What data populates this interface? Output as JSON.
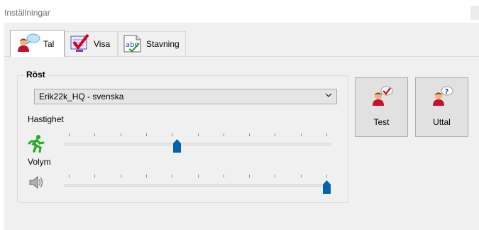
{
  "window": {
    "title": "Inställningar"
  },
  "tabs": [
    {
      "label": "Tal",
      "icon": "speaker-person-icon",
      "active": true
    },
    {
      "label": "Visa",
      "icon": "checkmark-monitor-icon",
      "active": false
    },
    {
      "label": "Stavning",
      "icon": "abc-spelling-icon",
      "active": false
    }
  ],
  "voice_group": {
    "title": "Röst",
    "voice_select": {
      "value": "Erik22k_HQ - svenska"
    },
    "speed": {
      "label": "Hastighet",
      "value": 0.42
    },
    "volume": {
      "label": "Volym",
      "value": 1.0
    }
  },
  "buttons": {
    "test": {
      "label": "Test"
    },
    "pronounce": {
      "label": "Uttal"
    }
  },
  "colors": {
    "thumb": "#0063b1",
    "runner": "#22aa22"
  }
}
